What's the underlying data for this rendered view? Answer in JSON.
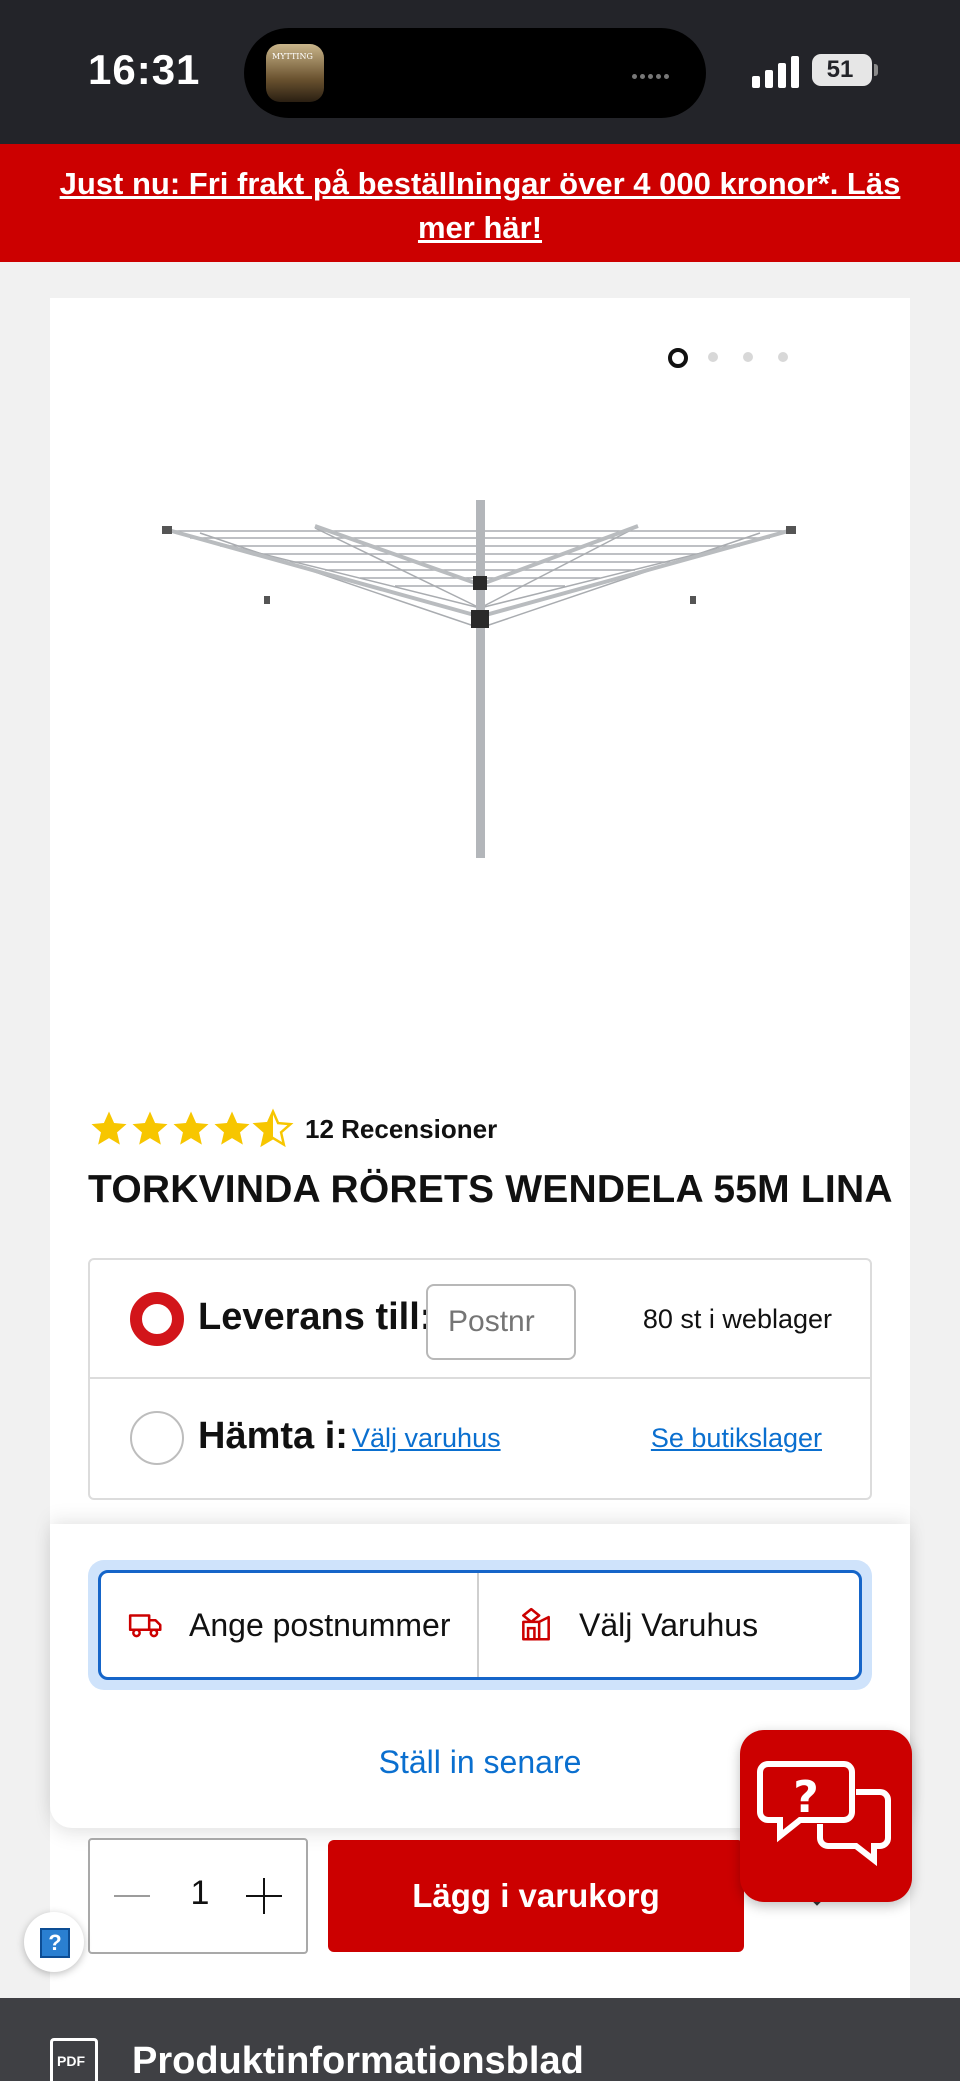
{
  "status_bar": {
    "time": "16:31",
    "battery": "51"
  },
  "promo": {
    "text": "Just nu: Fri frakt på beställningar över 4 000 kronor*. Läs mer här!"
  },
  "product": {
    "rating": 4.5,
    "reviews": "12 Recensioner",
    "title": "TORKVINDA RÖRETS WENDELA 55M LINA",
    "carousel": {
      "count": 4,
      "active": 1
    }
  },
  "delivery": {
    "delivery_label": "Leverans till:",
    "postnr_placeholder": "Postnr",
    "stock_text": "80 st i weblager",
    "pickup_label": "Hämta i:",
    "choose_store_link": "Välj varuhus",
    "store_stock_link": "Se butikslager"
  },
  "popup": {
    "postal_option": "Ange postnummer",
    "store_option": "Välj Varuhus",
    "later_link": "Ställ in senare"
  },
  "cart": {
    "quantity": "1",
    "add_button": "Lägg i varukorg"
  },
  "bottom": {
    "pdf_icon_text": "PDF",
    "label": "Produktinformationsblad"
  },
  "colors": {
    "brand_red": "#cc0000",
    "link_blue": "#0a6fcf",
    "star_yellow": "#f7c600"
  },
  "icons": [
    "truck-icon",
    "store-icon",
    "chat-icon",
    "pdf-icon",
    "help-icon",
    "chevron-down-icon"
  ]
}
